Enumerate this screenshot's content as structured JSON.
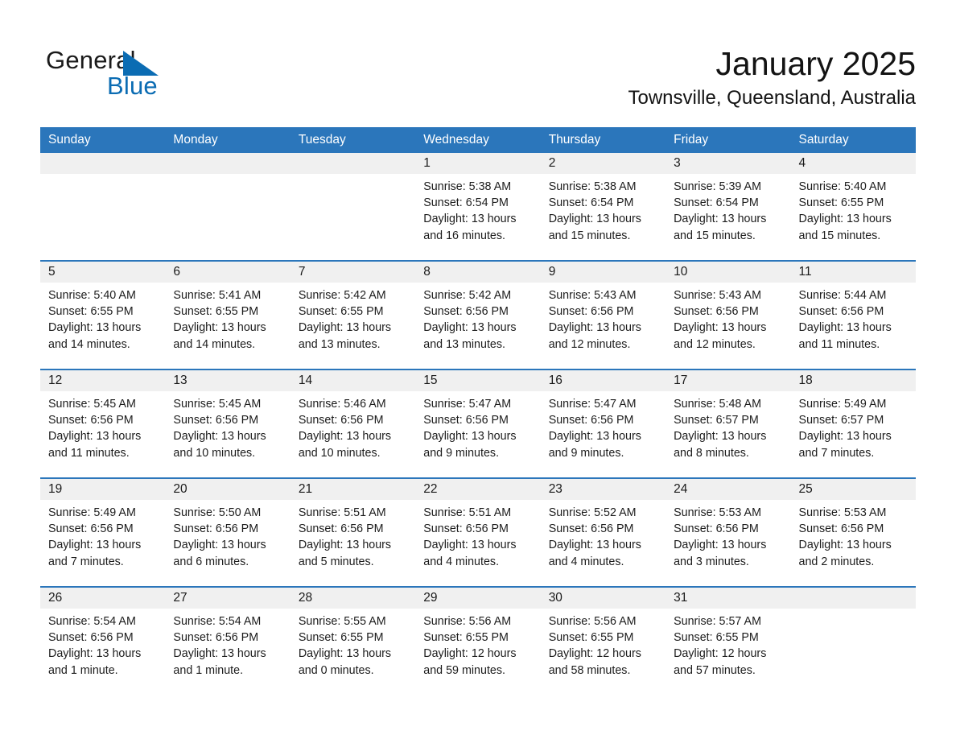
{
  "brand": {
    "line1": "General",
    "line2": "Blue",
    "triangle_color": "#0b6cb3",
    "text_color": "#1a1a1a"
  },
  "header": {
    "month_title": "January 2025",
    "location": "Townsville, Queensland, Australia"
  },
  "theme": {
    "header_bg": "#2b76bb",
    "header_text": "#ffffff",
    "daynum_bg": "#f0f0f0",
    "row_rule": "#2b76bb",
    "body_text": "#1c1c1c"
  },
  "weekday_headers": [
    "Sunday",
    "Monday",
    "Tuesday",
    "Wednesday",
    "Thursday",
    "Friday",
    "Saturday"
  ],
  "weeks": [
    [
      {
        "day": "",
        "empty": true,
        "sunrise": "",
        "sunset": "",
        "daylight_1": "",
        "daylight_2": ""
      },
      {
        "day": "",
        "empty": true,
        "sunrise": "",
        "sunset": "",
        "daylight_1": "",
        "daylight_2": ""
      },
      {
        "day": "",
        "empty": true,
        "sunrise": "",
        "sunset": "",
        "daylight_1": "",
        "daylight_2": ""
      },
      {
        "day": "1",
        "empty": false,
        "sunrise": "Sunrise: 5:38 AM",
        "sunset": "Sunset: 6:54 PM",
        "daylight_1": "Daylight: 13 hours",
        "daylight_2": "and 16 minutes."
      },
      {
        "day": "2",
        "empty": false,
        "sunrise": "Sunrise: 5:38 AM",
        "sunset": "Sunset: 6:54 PM",
        "daylight_1": "Daylight: 13 hours",
        "daylight_2": "and 15 minutes."
      },
      {
        "day": "3",
        "empty": false,
        "sunrise": "Sunrise: 5:39 AM",
        "sunset": "Sunset: 6:54 PM",
        "daylight_1": "Daylight: 13 hours",
        "daylight_2": "and 15 minutes."
      },
      {
        "day": "4",
        "empty": false,
        "sunrise": "Sunrise: 5:40 AM",
        "sunset": "Sunset: 6:55 PM",
        "daylight_1": "Daylight: 13 hours",
        "daylight_2": "and 15 minutes."
      }
    ],
    [
      {
        "day": "5",
        "empty": false,
        "sunrise": "Sunrise: 5:40 AM",
        "sunset": "Sunset: 6:55 PM",
        "daylight_1": "Daylight: 13 hours",
        "daylight_2": "and 14 minutes."
      },
      {
        "day": "6",
        "empty": false,
        "sunrise": "Sunrise: 5:41 AM",
        "sunset": "Sunset: 6:55 PM",
        "daylight_1": "Daylight: 13 hours",
        "daylight_2": "and 14 minutes."
      },
      {
        "day": "7",
        "empty": false,
        "sunrise": "Sunrise: 5:42 AM",
        "sunset": "Sunset: 6:55 PM",
        "daylight_1": "Daylight: 13 hours",
        "daylight_2": "and 13 minutes."
      },
      {
        "day": "8",
        "empty": false,
        "sunrise": "Sunrise: 5:42 AM",
        "sunset": "Sunset: 6:56 PM",
        "daylight_1": "Daylight: 13 hours",
        "daylight_2": "and 13 minutes."
      },
      {
        "day": "9",
        "empty": false,
        "sunrise": "Sunrise: 5:43 AM",
        "sunset": "Sunset: 6:56 PM",
        "daylight_1": "Daylight: 13 hours",
        "daylight_2": "and 12 minutes."
      },
      {
        "day": "10",
        "empty": false,
        "sunrise": "Sunrise: 5:43 AM",
        "sunset": "Sunset: 6:56 PM",
        "daylight_1": "Daylight: 13 hours",
        "daylight_2": "and 12 minutes."
      },
      {
        "day": "11",
        "empty": false,
        "sunrise": "Sunrise: 5:44 AM",
        "sunset": "Sunset: 6:56 PM",
        "daylight_1": "Daylight: 13 hours",
        "daylight_2": "and 11 minutes."
      }
    ],
    [
      {
        "day": "12",
        "empty": false,
        "sunrise": "Sunrise: 5:45 AM",
        "sunset": "Sunset: 6:56 PM",
        "daylight_1": "Daylight: 13 hours",
        "daylight_2": "and 11 minutes."
      },
      {
        "day": "13",
        "empty": false,
        "sunrise": "Sunrise: 5:45 AM",
        "sunset": "Sunset: 6:56 PM",
        "daylight_1": "Daylight: 13 hours",
        "daylight_2": "and 10 minutes."
      },
      {
        "day": "14",
        "empty": false,
        "sunrise": "Sunrise: 5:46 AM",
        "sunset": "Sunset: 6:56 PM",
        "daylight_1": "Daylight: 13 hours",
        "daylight_2": "and 10 minutes."
      },
      {
        "day": "15",
        "empty": false,
        "sunrise": "Sunrise: 5:47 AM",
        "sunset": "Sunset: 6:56 PM",
        "daylight_1": "Daylight: 13 hours",
        "daylight_2": "and 9 minutes."
      },
      {
        "day": "16",
        "empty": false,
        "sunrise": "Sunrise: 5:47 AM",
        "sunset": "Sunset: 6:56 PM",
        "daylight_1": "Daylight: 13 hours",
        "daylight_2": "and 9 minutes."
      },
      {
        "day": "17",
        "empty": false,
        "sunrise": "Sunrise: 5:48 AM",
        "sunset": "Sunset: 6:57 PM",
        "daylight_1": "Daylight: 13 hours",
        "daylight_2": "and 8 minutes."
      },
      {
        "day": "18",
        "empty": false,
        "sunrise": "Sunrise: 5:49 AM",
        "sunset": "Sunset: 6:57 PM",
        "daylight_1": "Daylight: 13 hours",
        "daylight_2": "and 7 minutes."
      }
    ],
    [
      {
        "day": "19",
        "empty": false,
        "sunrise": "Sunrise: 5:49 AM",
        "sunset": "Sunset: 6:56 PM",
        "daylight_1": "Daylight: 13 hours",
        "daylight_2": "and 7 minutes."
      },
      {
        "day": "20",
        "empty": false,
        "sunrise": "Sunrise: 5:50 AM",
        "sunset": "Sunset: 6:56 PM",
        "daylight_1": "Daylight: 13 hours",
        "daylight_2": "and 6 minutes."
      },
      {
        "day": "21",
        "empty": false,
        "sunrise": "Sunrise: 5:51 AM",
        "sunset": "Sunset: 6:56 PM",
        "daylight_1": "Daylight: 13 hours",
        "daylight_2": "and 5 minutes."
      },
      {
        "day": "22",
        "empty": false,
        "sunrise": "Sunrise: 5:51 AM",
        "sunset": "Sunset: 6:56 PM",
        "daylight_1": "Daylight: 13 hours",
        "daylight_2": "and 4 minutes."
      },
      {
        "day": "23",
        "empty": false,
        "sunrise": "Sunrise: 5:52 AM",
        "sunset": "Sunset: 6:56 PM",
        "daylight_1": "Daylight: 13 hours",
        "daylight_2": "and 4 minutes."
      },
      {
        "day": "24",
        "empty": false,
        "sunrise": "Sunrise: 5:53 AM",
        "sunset": "Sunset: 6:56 PM",
        "daylight_1": "Daylight: 13 hours",
        "daylight_2": "and 3 minutes."
      },
      {
        "day": "25",
        "empty": false,
        "sunrise": "Sunrise: 5:53 AM",
        "sunset": "Sunset: 6:56 PM",
        "daylight_1": "Daylight: 13 hours",
        "daylight_2": "and 2 minutes."
      }
    ],
    [
      {
        "day": "26",
        "empty": false,
        "sunrise": "Sunrise: 5:54 AM",
        "sunset": "Sunset: 6:56 PM",
        "daylight_1": "Daylight: 13 hours",
        "daylight_2": "and 1 minute."
      },
      {
        "day": "27",
        "empty": false,
        "sunrise": "Sunrise: 5:54 AM",
        "sunset": "Sunset: 6:56 PM",
        "daylight_1": "Daylight: 13 hours",
        "daylight_2": "and 1 minute."
      },
      {
        "day": "28",
        "empty": false,
        "sunrise": "Sunrise: 5:55 AM",
        "sunset": "Sunset: 6:55 PM",
        "daylight_1": "Daylight: 13 hours",
        "daylight_2": "and 0 minutes."
      },
      {
        "day": "29",
        "empty": false,
        "sunrise": "Sunrise: 5:56 AM",
        "sunset": "Sunset: 6:55 PM",
        "daylight_1": "Daylight: 12 hours",
        "daylight_2": "and 59 minutes."
      },
      {
        "day": "30",
        "empty": false,
        "sunrise": "Sunrise: 5:56 AM",
        "sunset": "Sunset: 6:55 PM",
        "daylight_1": "Daylight: 12 hours",
        "daylight_2": "and 58 minutes."
      },
      {
        "day": "31",
        "empty": false,
        "sunrise": "Sunrise: 5:57 AM",
        "sunset": "Sunset: 6:55 PM",
        "daylight_1": "Daylight: 12 hours",
        "daylight_2": "and 57 minutes."
      },
      {
        "day": "",
        "empty": true,
        "sunrise": "",
        "sunset": "",
        "daylight_1": "",
        "daylight_2": ""
      }
    ]
  ]
}
